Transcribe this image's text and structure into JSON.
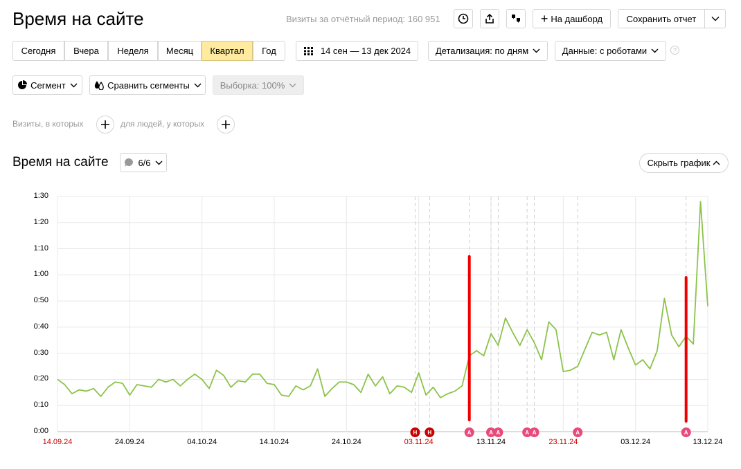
{
  "header": {
    "title": "Время на сайте",
    "visits_label": "Визиты за отчётный период: 160 951",
    "dashboard_label": "На дашборд",
    "save_label": "Сохранить отчет"
  },
  "periods": [
    "Сегодня",
    "Вчера",
    "Неделя",
    "Месяц",
    "Квартал",
    "Год"
  ],
  "active_period": "Квартал",
  "date_range": "14 сен — 13 дек 2024",
  "detail": "Детализация: по дням",
  "data_filter": "Данные: с роботами",
  "segment_label": "Сегмент",
  "compare_label": "Сравнить сегменты",
  "sample_label": "Выборка: 100%",
  "filters": {
    "visits_label": "Визиты, в которых",
    "people_label": "для людей, у которых"
  },
  "chart_section": {
    "title": "Время на сайте",
    "annotations_count": "6/6",
    "hide_label": "Скрыть график"
  },
  "colors": {
    "line": "#8bc34a",
    "annotation_red": "#cc0000",
    "annotation_pink": "#e84a7a",
    "highlight_bar": "#ee0000",
    "active_period_bg": "#ffeba0"
  },
  "chart_data": {
    "type": "line",
    "y_ticks": [
      "0:00",
      "0:10",
      "0:20",
      "0:30",
      "0:40",
      "0:50",
      "1:00",
      "1:10",
      "1:20",
      "1:30"
    ],
    "ylim_seconds": [
      0,
      90
    ],
    "x_ticks": [
      {
        "label": "14.09.24",
        "day": 0,
        "red": true
      },
      {
        "label": "24.09.24",
        "day": 10,
        "red": false
      },
      {
        "label": "04.10.24",
        "day": 20,
        "red": false
      },
      {
        "label": "14.10.24",
        "day": 30,
        "red": false
      },
      {
        "label": "24.10.24",
        "day": 40,
        "red": false
      },
      {
        "label": "03.11.24",
        "day": 50,
        "red": true
      },
      {
        "label": "13.11.24",
        "day": 60,
        "red": false
      },
      {
        "label": "23.11.24",
        "day": 70,
        "red": true
      },
      {
        "label": "03.12.24",
        "day": 80,
        "red": false
      },
      {
        "label": "13.12.24",
        "day": 90,
        "red": false
      }
    ],
    "series": [
      {
        "values_seconds": [
          20,
          18,
          14.5,
          16,
          15.5,
          16.5,
          13.5,
          17,
          19,
          18.5,
          14,
          18,
          17.5,
          17,
          20,
          19,
          20,
          17.5,
          20,
          22,
          20,
          16.5,
          23.5,
          21.5,
          17,
          19.5,
          19,
          22,
          22,
          18.5,
          18,
          14,
          13.5,
          17.5,
          16,
          17.5,
          24,
          13.5,
          16.5,
          19,
          19,
          18,
          15,
          22,
          17.5,
          21,
          14.5,
          17.5,
          17,
          15,
          22.5,
          14,
          17,
          13,
          14.5,
          15.5,
          17.5,
          29,
          31,
          29,
          37.5,
          33,
          43.5,
          38,
          33,
          39,
          34,
          27.5,
          42,
          39,
          23,
          23.5,
          25,
          31.5,
          38,
          37,
          38,
          27.5,
          39,
          32,
          25.5,
          27.5,
          24,
          31,
          51,
          37,
          32.5,
          36.5,
          33.5,
          88,
          48
        ]
      }
    ],
    "annotations": [
      {
        "day": 49.5,
        "letter": "Н",
        "kind": "holiday"
      },
      {
        "day": 51.5,
        "letter": "Н",
        "kind": "holiday"
      },
      {
        "day": 57,
        "letter": "А",
        "kind": "annotation"
      },
      {
        "day": 60,
        "letter": "А",
        "kind": "annotation"
      },
      {
        "day": 61,
        "letter": "А",
        "kind": "annotation"
      },
      {
        "day": 65,
        "letter": "А",
        "kind": "annotation"
      },
      {
        "day": 66,
        "letter": "А",
        "kind": "annotation"
      },
      {
        "day": 72,
        "letter": "А",
        "kind": "annotation"
      },
      {
        "day": 87,
        "letter": "А",
        "kind": "annotation"
      }
    ],
    "highlight_bars": [
      {
        "day": 57,
        "from_seconds": 4.5,
        "to_seconds": 67
      },
      {
        "day": 87,
        "from_seconds": 4,
        "to_seconds": 59
      }
    ]
  }
}
